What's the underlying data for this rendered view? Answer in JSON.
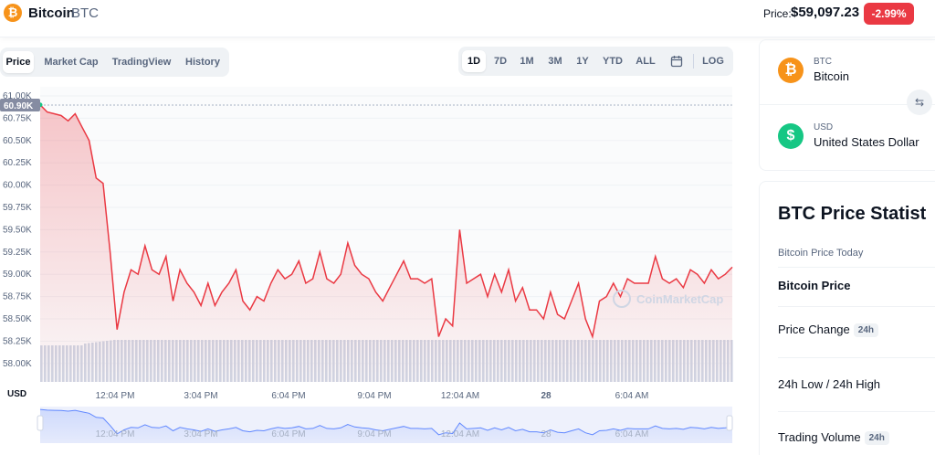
{
  "header": {
    "coin_name": "Bitcoin",
    "coin_symbol": "BTC",
    "coin_icon": "bitcoin-icon",
    "price_label": "Price:",
    "price_value": "$59,097.23",
    "change": "-2.99%",
    "change_color": "#ea3943"
  },
  "chart_tabs": [
    "Price",
    "Market Cap",
    "TradingView",
    "History"
  ],
  "chart_tabs_active": "Price",
  "ranges": {
    "items": [
      "1D",
      "7D",
      "1M",
      "3M",
      "1Y",
      "YTD",
      "ALL"
    ],
    "active": "1D",
    "calendar_icon": "calendar-icon",
    "log_label": "LOG"
  },
  "chart_data": {
    "type": "area",
    "currency_label": "USD",
    "y_ticks": [
      "61.00K",
      "60.75K",
      "60.50K",
      "60.25K",
      "60.00K",
      "59.75K",
      "59.50K",
      "59.25K",
      "59.00K",
      "58.75K",
      "58.50K",
      "58.25K",
      "58.00K"
    ],
    "ylim": [
      58000,
      61000
    ],
    "x_ticks": [
      "12:04 PM",
      "3:04 PM",
      "6:04 PM",
      "9:04 PM",
      "12:04 AM",
      "28",
      "6:04 AM"
    ],
    "open_marker": "60.90K",
    "series": [
      {
        "values": [
          60900,
          60820,
          60800,
          60780,
          60720,
          60800,
          60650,
          60500,
          60080,
          60020,
          59250,
          58380,
          58800,
          59050,
          59000,
          59320,
          59050,
          59000,
          59200,
          58700,
          59050,
          58900,
          58800,
          58650,
          58900,
          58650,
          58800,
          58900,
          59050,
          58700,
          58600,
          58750,
          58700,
          58900,
          59050,
          58950,
          59000,
          59150,
          58900,
          58950,
          59250,
          58950,
          58900,
          59000,
          59350,
          59100,
          59000,
          58950,
          58800,
          58700,
          58850,
          59000,
          59150,
          58950,
          58950,
          58900,
          58950,
          58300,
          58500,
          58420,
          59500,
          58900,
          58950,
          59000,
          58750,
          59000,
          58800,
          59050,
          58700,
          58850,
          58600,
          58600,
          58500,
          58800,
          58550,
          58500,
          58700,
          58900,
          58500,
          58300,
          58700,
          58750,
          58900,
          58750,
          58950,
          58900,
          58900,
          58900,
          59200,
          58950,
          58900,
          58950,
          58850,
          59050,
          59000,
          58900,
          59050,
          58950,
          59000,
          59080
        ],
        "color": "#ea3943"
      }
    ],
    "volume_color": "#cfd6e4",
    "grid": true,
    "watermark": "CoinMarketCap"
  },
  "converter": {
    "from_symbol": "BTC",
    "from_name": "Bitcoin",
    "from_icon": "bitcoin-icon",
    "to_symbol": "USD",
    "to_name": "United States Dollar",
    "to_icon": "dollar-icon",
    "swap_icon": "swap-arrows-icon"
  },
  "stats": {
    "title": "BTC Price Statist",
    "subtitle": "Bitcoin Price Today",
    "rows": [
      {
        "label": "Bitcoin Price",
        "badge": ""
      },
      {
        "label": "Price Change",
        "badge": "24h"
      },
      {
        "label": "24h Low / 24h High",
        "badge": ""
      },
      {
        "label": "Trading Volume",
        "badge": "24h"
      }
    ]
  }
}
